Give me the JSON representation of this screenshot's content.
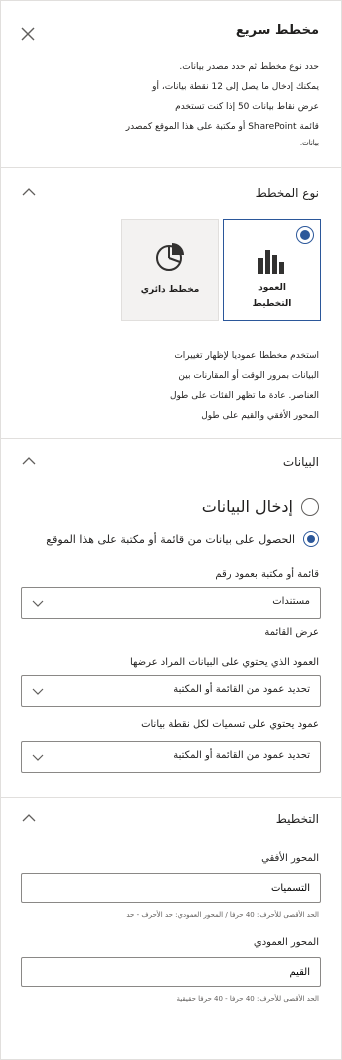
{
  "panel": {
    "title": "مخطط سريع",
    "description_lines": [
      "حدد نوع مخطط ثم حدد مصدر بيانات.",
      "يمكنك إدخال ما يصل إلى 12 نقطة بيانات، أو",
      "عرض نقاط بيانات 50 إذا كنت تستخدم",
      "قائمة SharePoint أو مكتبة على هذا الموقع كمصدر",
      "بيانات."
    ]
  },
  "chart_type": {
    "section_title": "نوع المخطط",
    "options": [
      {
        "label_line1": "العمود",
        "label_line2": "التخطيط",
        "selected": true,
        "icon": "bar-chart-icon"
      },
      {
        "label_line1": "مخطط دائري",
        "label_line2": "",
        "selected": false,
        "icon": "pie-chart-icon"
      }
    ],
    "description_lines": [
      "استخدم مخططا عموديا لإظهار تغييرات",
      "البيانات بمرور الوقت أو المقارنات بين",
      "العناصر. عادة ما تظهر الفئات على طول",
      "المحور الأفقي والقيم على طول"
    ]
  },
  "data": {
    "section_title": "البيانات",
    "radio_manual": "إدخال البيانات",
    "radio_list": "الحصول على بيانات من قائمة أو مكتبة على هذا الموقع",
    "list_label": "قائمة أو مكتبة بعمود رقم",
    "list_value": "مستندات",
    "view_label": "عرض القائمة",
    "column_label": "العمود الذي يحتوي على البيانات المراد عرضها",
    "column_value": "تحديد عمود من القائمة أو المكتبة",
    "labels_label": "عمود يحتوي على تسميات لكل نقطة بيانات",
    "labels_value": "تحديد عمود من القائمة أو المكتبة"
  },
  "layout": {
    "section_title": "التخطيط",
    "horizontal_label": "المحور الأفقي",
    "horizontal_value": "التسميات",
    "horizontal_hint": "الحد الأقصى للأحرف: 40 حرفا / المحور العمودي: حد الأحرف - حد",
    "vertical_label": "المحور العمودي",
    "vertical_value": "القيم",
    "vertical_hint": "الحد الأقصى للأحرف: 40 حرفا - 40 حرفا حقيقية"
  },
  "colors": {
    "accent": "#2b579a",
    "border": "#e1dfdd"
  }
}
